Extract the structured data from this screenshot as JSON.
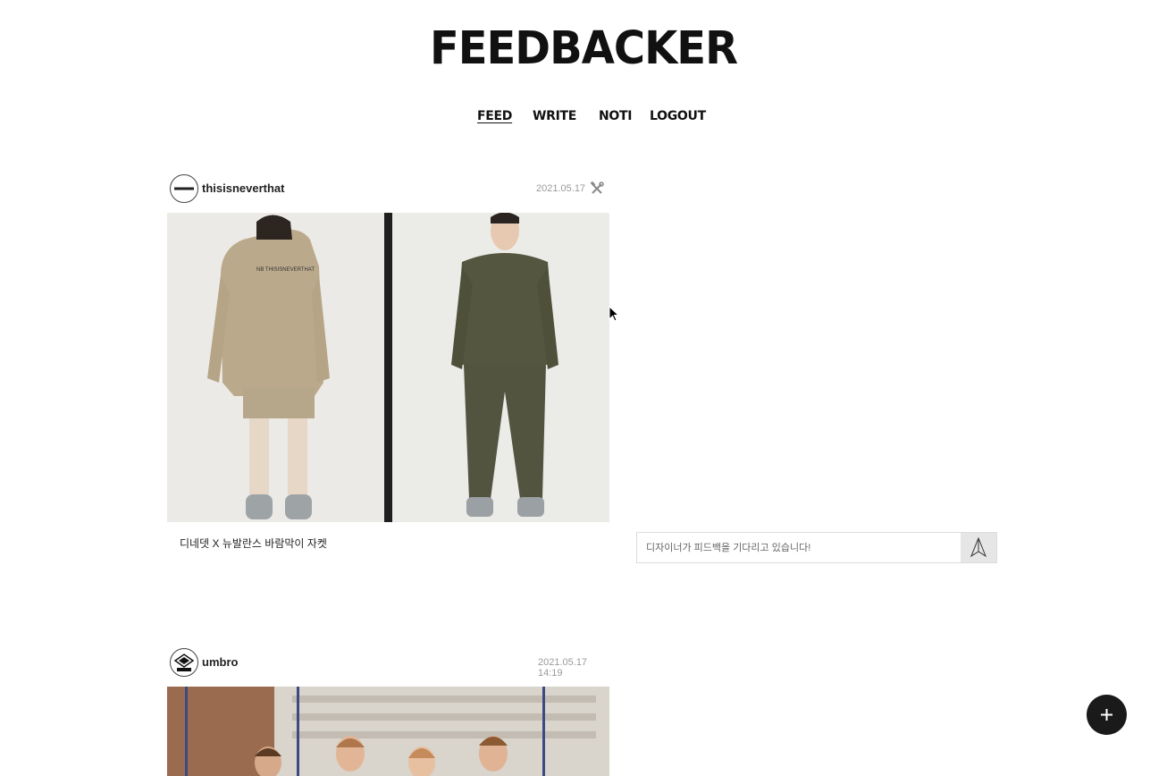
{
  "app": {
    "title": "FEEDBACKER"
  },
  "nav": {
    "items": [
      "FEED",
      "WRITE",
      "NOTI",
      "LOGOUT"
    ],
    "active": "FEED"
  },
  "posts": [
    {
      "username": "thisisneverthat",
      "date": "2021.05.17",
      "caption": "디네뎃 X 뉴발란스 바람막이 자켓",
      "edit_icon": "hammer-wrench-icon",
      "comment": {
        "placeholder": "디자이너가 피드백을 기다리고 있습니다!",
        "value": "",
        "send_icon": "send-icon"
      }
    },
    {
      "username": "umbro",
      "date": "2021.05.17 14:19"
    }
  ],
  "fab": {
    "label": "+",
    "icon": "plus-icon"
  },
  "colors": {
    "text": "#111111",
    "date": "#9a9a9a",
    "fab_bg": "#1a1a1a",
    "send_bg": "#e6e6e6",
    "border": "#dddddd"
  }
}
